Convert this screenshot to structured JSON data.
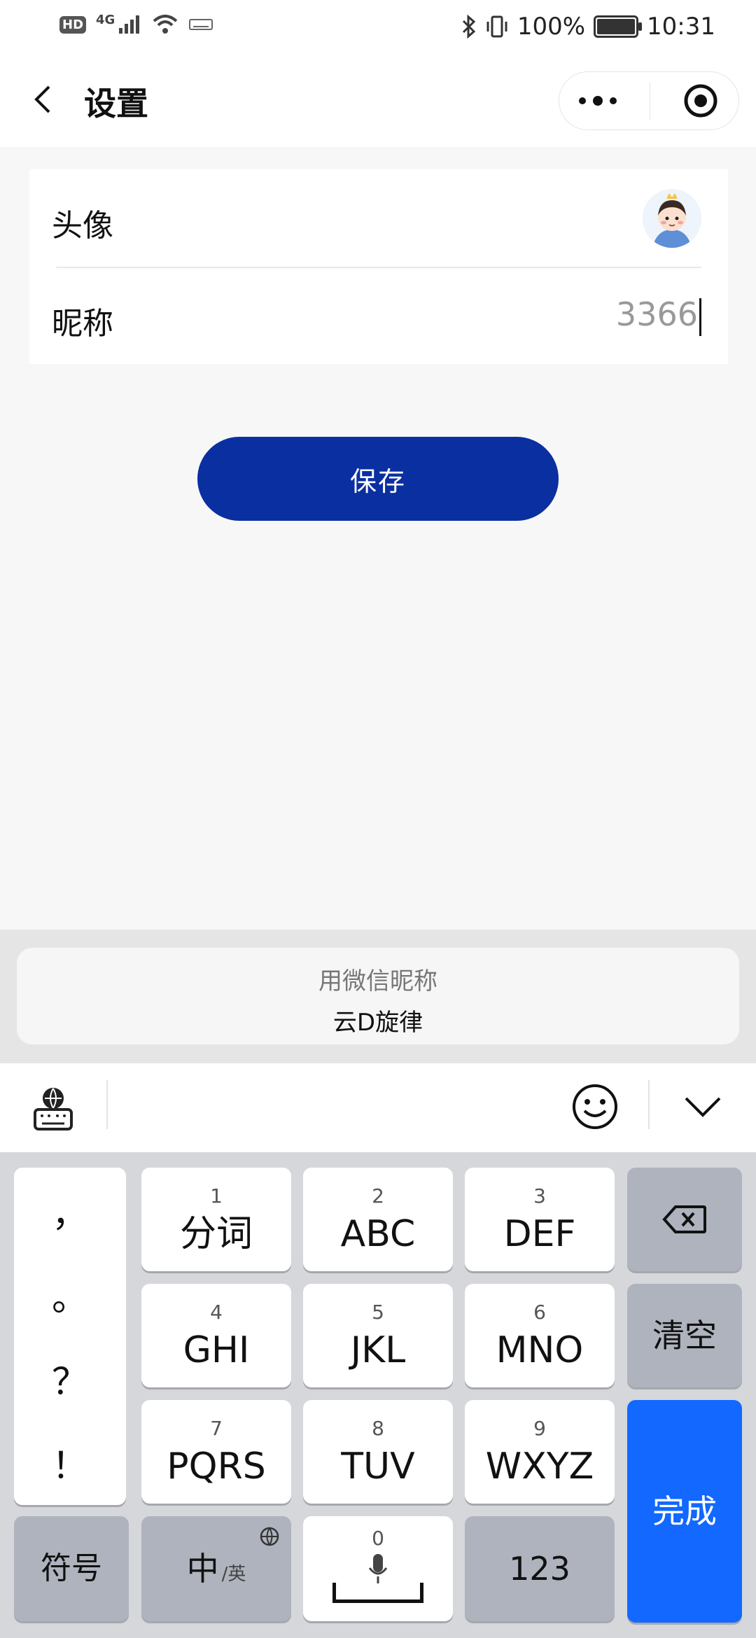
{
  "status_bar": {
    "left_icons": [
      "HD",
      "4G",
      "signal-icon",
      "wifi-icon",
      "keyboard-indicator-icon"
    ],
    "network": "4G",
    "hd": "HD",
    "battery": "100%",
    "time": "10:31",
    "right_icons": [
      "bluetooth-icon",
      "vibrate-icon",
      "battery-charging-icon"
    ]
  },
  "header": {
    "title": "设置",
    "icons": [
      "back-icon",
      "more-icon",
      "close-target-icon"
    ]
  },
  "settings": {
    "avatar_label": "头像",
    "nickname_label": "昵称",
    "nickname_value": "3366"
  },
  "save_button": "保存",
  "nickname_suggestion": {
    "hint": "用微信昵称",
    "name": "云D旋律"
  },
  "keyboard_toolbar": {
    "icons": [
      "keyboard-settings-icon",
      "emoji-icon",
      "collapse-keyboard-icon"
    ]
  },
  "keyboard": {
    "punctuation": [
      "，",
      "。",
      "？",
      "！"
    ],
    "keys": [
      {
        "num": "1",
        "label": "分词"
      },
      {
        "num": "2",
        "label": "ABC"
      },
      {
        "num": "3",
        "label": "DEF"
      },
      {
        "num": "4",
        "label": "GHI"
      },
      {
        "num": "5",
        "label": "JKL"
      },
      {
        "num": "6",
        "label": "MNO"
      },
      {
        "num": "7",
        "label": "PQRS"
      },
      {
        "num": "8",
        "label": "TUV"
      },
      {
        "num": "9",
        "label": "WXYZ"
      }
    ],
    "clear": "清空",
    "symbol": "符号",
    "lang_main": "中",
    "lang_sub": "/英",
    "space_num": "0",
    "num_mode": "123",
    "done": "完成"
  },
  "colors": {
    "save_button": "#0a2fa0",
    "done_key": "#1268ff",
    "keyboard_bg": "#d5d7db"
  }
}
